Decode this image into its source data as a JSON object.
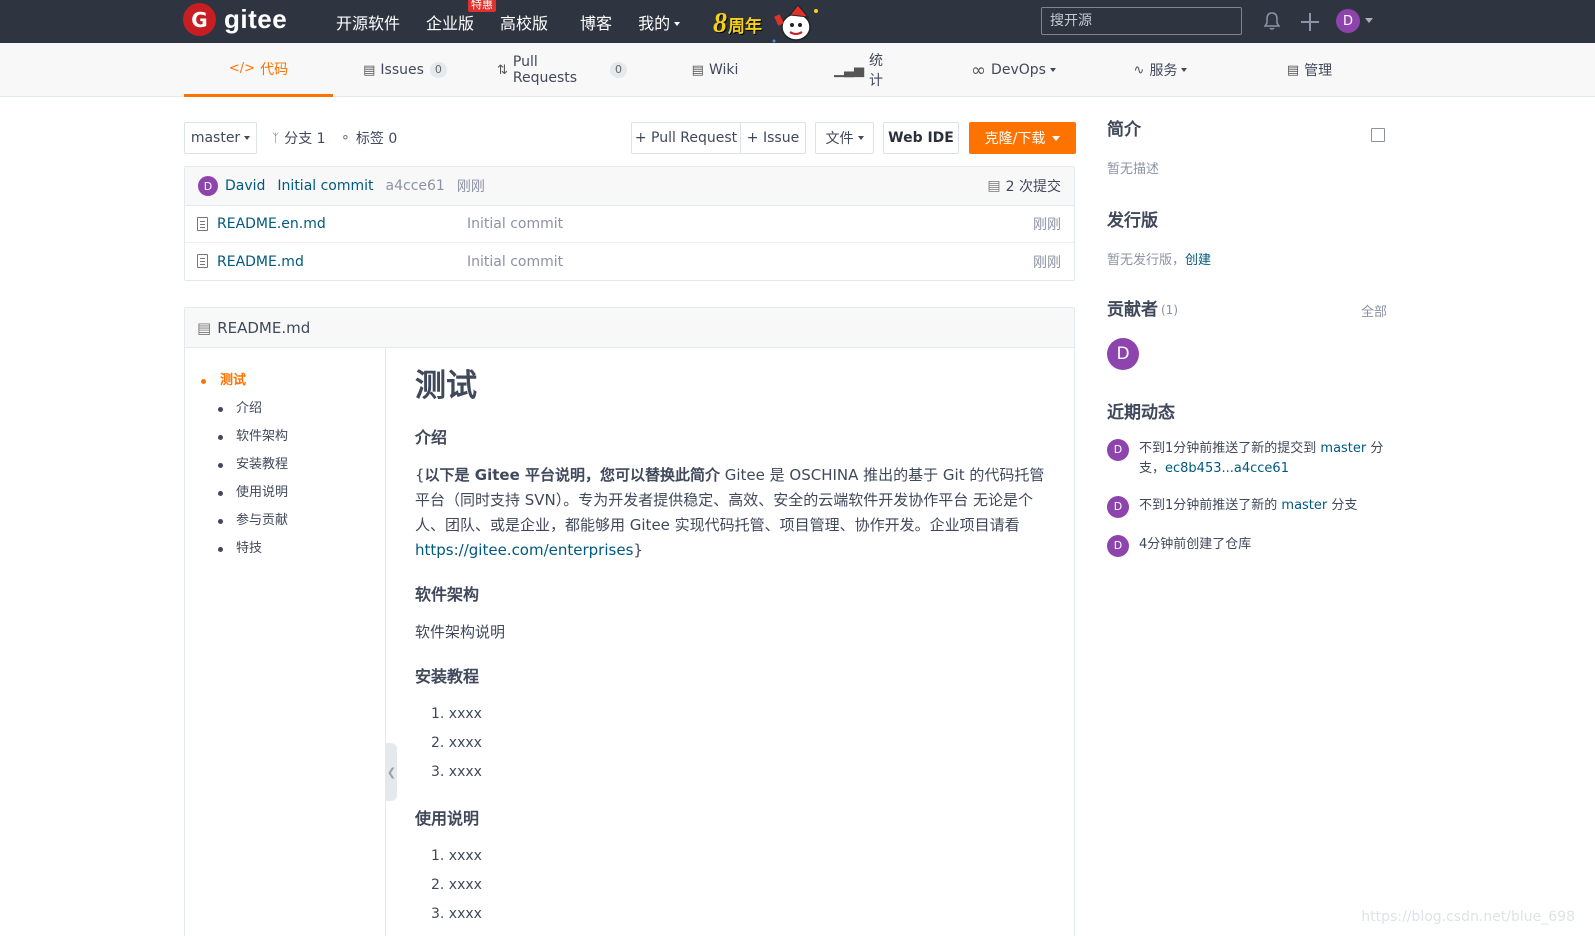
{
  "topbar": {
    "logo_letter": "G",
    "logo_text": "gitee",
    "nav": [
      "开源软件",
      "企业版",
      "高校版",
      "博客",
      "我的"
    ],
    "enterprise_badge": "特惠",
    "anniversary_number": "8",
    "anniversary_text": "周年",
    "search_placeholder": "搜开源",
    "user_initial": "D"
  },
  "tabs": {
    "code": "代码",
    "issues": "Issues",
    "issues_count": "0",
    "pull_requests": "Pull Requests",
    "pull_requests_count": "0",
    "wiki": "Wiki",
    "stats": "统计",
    "devops": "DevOps",
    "services": "服务",
    "manage": "管理"
  },
  "toolbar": {
    "branch": "master",
    "branches": "分支 1",
    "tags": "标签 0",
    "pull_request_btn": "+ Pull Request",
    "issue_btn": "+ Issue",
    "file_btn": "文件",
    "webide_btn": "Web IDE",
    "clone_btn": "克隆/下载"
  },
  "commit": {
    "author_initial": "D",
    "author": "David",
    "message": "Initial commit",
    "hash": "a4cce61",
    "time": "刚刚",
    "count": "2 次提交"
  },
  "files": [
    {
      "name": "README.en.md",
      "message": "Initial commit",
      "time": "刚刚"
    },
    {
      "name": "README.md",
      "message": "Initial commit",
      "time": "刚刚"
    }
  ],
  "readme": {
    "filename": "README.md",
    "toc": {
      "title": "测试",
      "items": [
        "介绍",
        "软件架构",
        "安装教程",
        "使用说明",
        "参与贡献",
        "特技"
      ]
    },
    "h1": "测试",
    "h_intro": "介绍",
    "intro_open": "{",
    "intro_bold": "以下是 Gitee 平台说明，您可以替换此简介",
    "intro_text": " Gitee 是 OSCHINA 推出的基于 Git 的代码托管平台（同时支持 SVN）。专为开发者提供稳定、高效、安全的云端软件开发协作平台 无论是个人、团队、或是企业，都能够用 Gitee 实现代码托管、项目管理、协作开发。企业项目请看 ",
    "intro_link": "https://gitee.com/enterprises",
    "intro_close": "}",
    "h_arch": "软件架构",
    "arch_text": "软件架构说明",
    "h_install": "安装教程",
    "install_steps": [
      "1. xxxx",
      "2. xxxx",
      "3. xxxx"
    ],
    "h_usage": "使用说明",
    "usage_steps": [
      "1. xxxx",
      "2. xxxx",
      "3. xxxx"
    ]
  },
  "sidebar": {
    "intro_title": "简介",
    "intro_desc": "暂无描述",
    "release_title": "发行版",
    "release_desc": "暂无发行版，",
    "release_create": "创建",
    "contrib_title": "贡献者",
    "contrib_count": "(1)",
    "contrib_all": "全部",
    "contrib_initial": "D",
    "activity_title": "近期动态",
    "activities": [
      {
        "initial": "D",
        "text": "不到1分钟前推送了新的提交到 ",
        "link": "master",
        "text2": " 分支，",
        "link2": "ec8b453...a4cce61"
      },
      {
        "initial": "D",
        "text": "不到1分钟前推送了新的 ",
        "link": "master",
        "text2": " 分支",
        "link2": ""
      },
      {
        "initial": "D",
        "text": "4分钟前创建了仓库",
        "link": "",
        "text2": "",
        "link2": ""
      }
    ]
  },
  "watermark": "https://blog.csdn.net/blue_698",
  "colors": {
    "accent": "#fe7300",
    "topbar": "#2e3440",
    "link": "#005980",
    "avatar": "#8e44ad"
  }
}
